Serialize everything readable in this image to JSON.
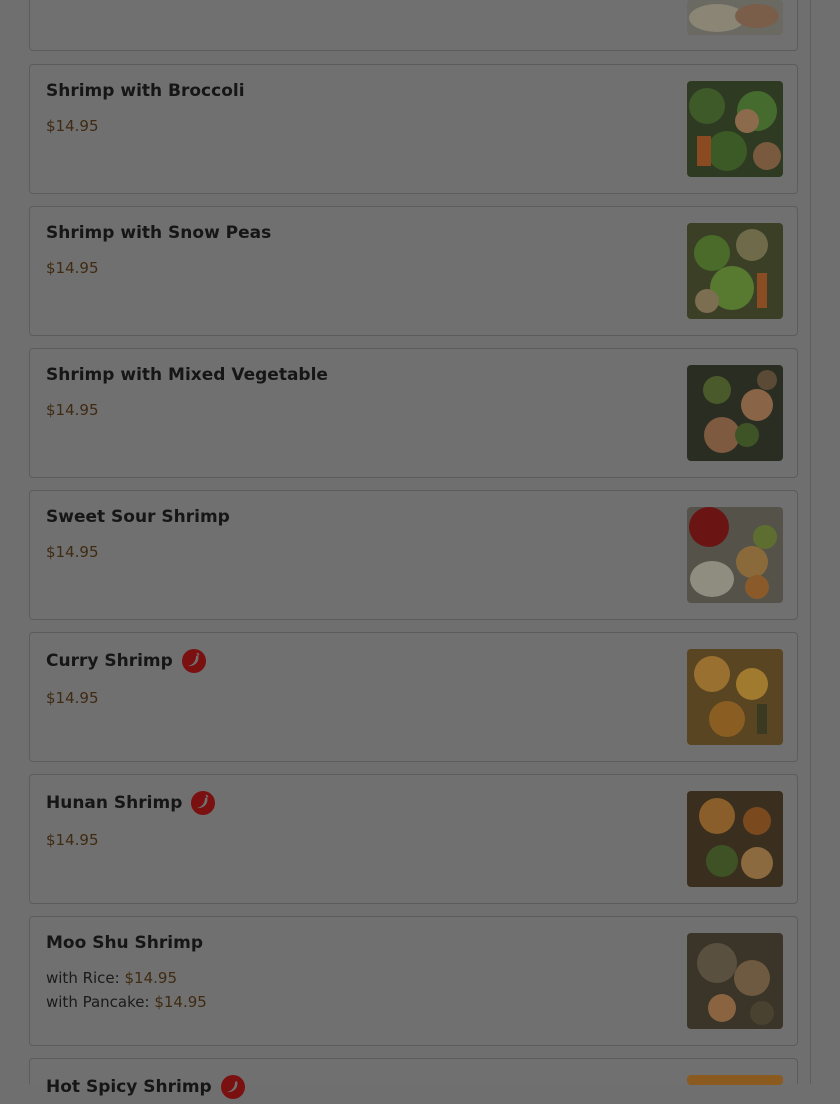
{
  "menu": {
    "items": [
      {
        "name": "Shrimp with Broccoli",
        "price": "$14.95",
        "spicy": false
      },
      {
        "name": "Shrimp with Snow Peas",
        "price": "$14.95",
        "spicy": false
      },
      {
        "name": "Shrimp with Mixed Vegetable",
        "price": "$14.95",
        "spicy": false
      },
      {
        "name": "Sweet Sour Shrimp",
        "price": "$14.95",
        "spicy": false
      },
      {
        "name": "Curry Shrimp",
        "price": "$14.95",
        "spicy": true
      },
      {
        "name": "Hunan Shrimp",
        "price": "$14.95",
        "spicy": true
      },
      {
        "name": "Moo Shu Shrimp",
        "spicy": false,
        "variants": [
          {
            "label": "with Rice:",
            "price": "$14.95"
          },
          {
            "label": "with Pancake:",
            "price": "$14.95"
          }
        ]
      },
      {
        "name": "Hot Spicy Shrimp",
        "spicy": true
      }
    ],
    "spicy_icon": "chili-pepper-icon",
    "colors": {
      "overlay": "#6f6f6f",
      "card": "#707070",
      "title": "#161616",
      "price": "#3f2a12",
      "spicy_badge": "#7a1010"
    }
  }
}
